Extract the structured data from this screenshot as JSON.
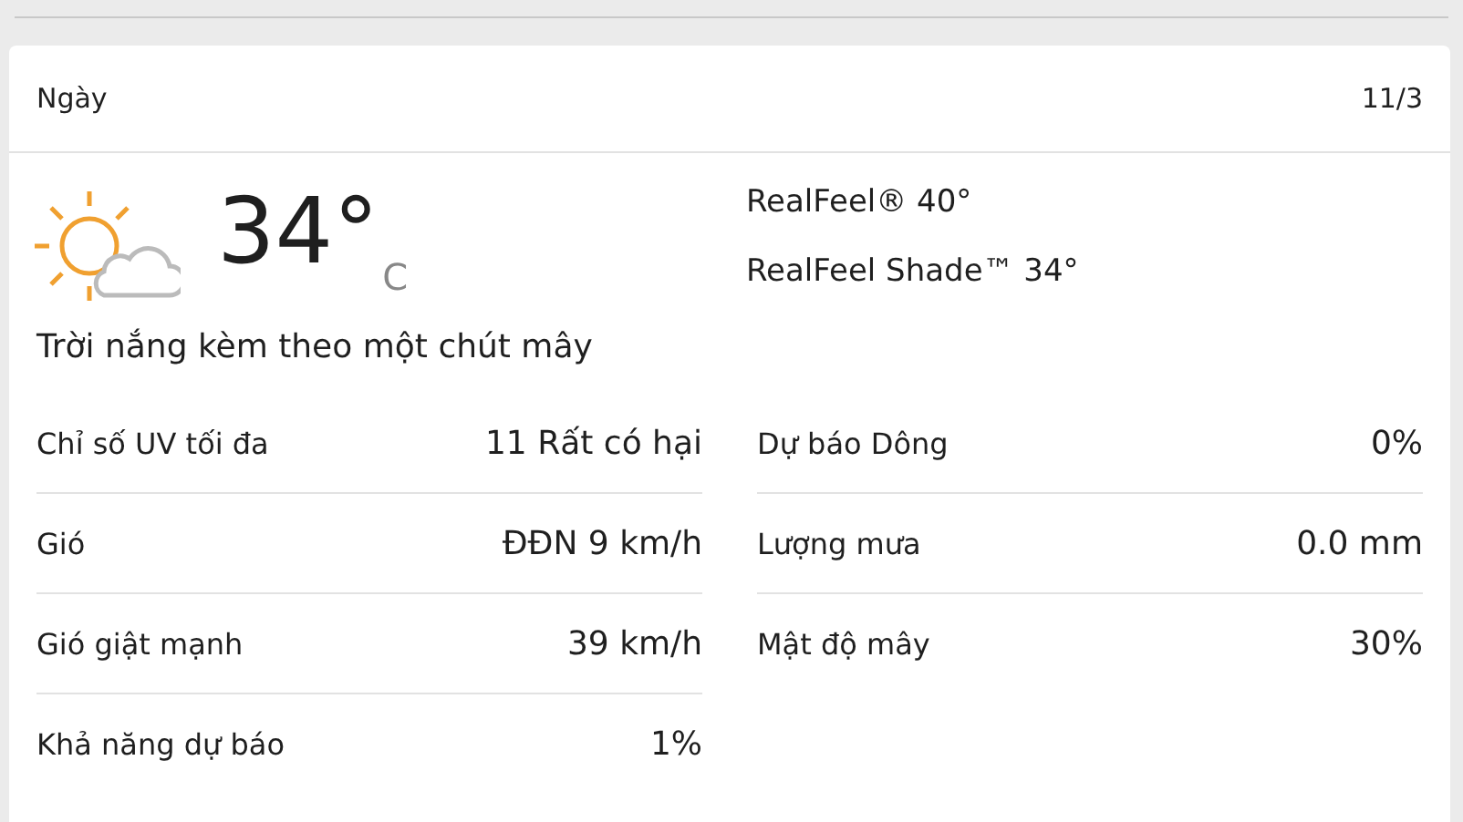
{
  "header": {
    "title": "Ngày",
    "date": "11/3"
  },
  "current": {
    "temperature": "34°",
    "unit": "C",
    "realfeel": [
      "RealFeel® 40°",
      "RealFeel Shade™ 34°"
    ]
  },
  "description": "Trời nắng kèm theo một chút mây",
  "details": [
    {
      "label": "Chỉ số UV tối đa",
      "value": "11 Rất có hại"
    },
    {
      "label": "Dự báo Dông",
      "value": "0%"
    },
    {
      "label": "Gió",
      "value": "ĐĐN 9 km/h"
    },
    {
      "label": "Lượng mưa",
      "value": "0.0 mm"
    },
    {
      "label": "Gió giật mạnh",
      "value": "39 km/h"
    },
    {
      "label": "Mật độ mây",
      "value": "30%"
    },
    {
      "label": "Khả năng dự báo",
      "value": "1%"
    }
  ]
}
